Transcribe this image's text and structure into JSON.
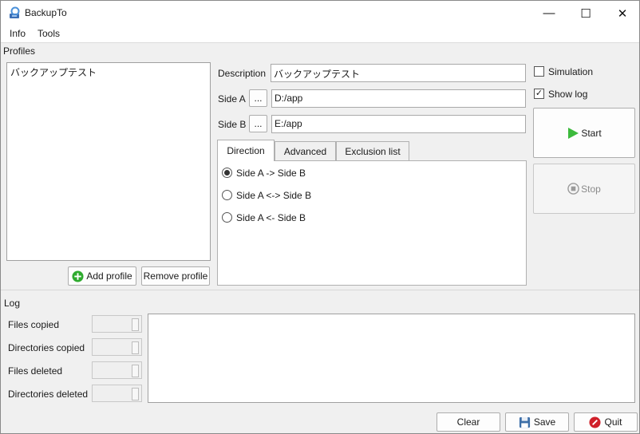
{
  "window": {
    "title": "BackupTo",
    "minimize_glyph": "—",
    "maximize_glyph": "☐",
    "close_glyph": "✕"
  },
  "menu": {
    "info": "Info",
    "tools": "Tools"
  },
  "profiles": {
    "section_label": "Profiles",
    "items": [
      "バックアップテスト"
    ],
    "add_label": "Add profile",
    "remove_label": "Remove profile"
  },
  "form": {
    "description_label": "Description",
    "description_value": "バックアップテスト",
    "side_a_label": "Side A",
    "side_a_value": "D:/app",
    "side_b_label": "Side B",
    "side_b_value": "E:/app",
    "browse_label": "..."
  },
  "tabs": {
    "direction": "Direction",
    "advanced": "Advanced",
    "exclusion": "Exclusion list"
  },
  "direction": {
    "options": [
      "Side A -> Side B",
      "Side A <-> Side B",
      "Side A <- Side B"
    ],
    "selected": 0
  },
  "options": {
    "simulation": "Simulation",
    "simulation_checked": false,
    "show_log": "Show log",
    "show_log_checked": true,
    "check_glyph": "✓"
  },
  "actions": {
    "start": "Start",
    "stop": "Stop"
  },
  "log": {
    "section_label": "Log",
    "files_copied": "Files copied",
    "dirs_copied": "Directories copied",
    "files_deleted": "Files deleted",
    "dirs_deleted": "Directories deleted"
  },
  "footer": {
    "clear": "Clear",
    "save": "Save",
    "quit": "Quit"
  },
  "colors": {
    "start_green": "#3cba3c",
    "quit_red": "#d0202a",
    "add_green": "#2eaa2e"
  }
}
